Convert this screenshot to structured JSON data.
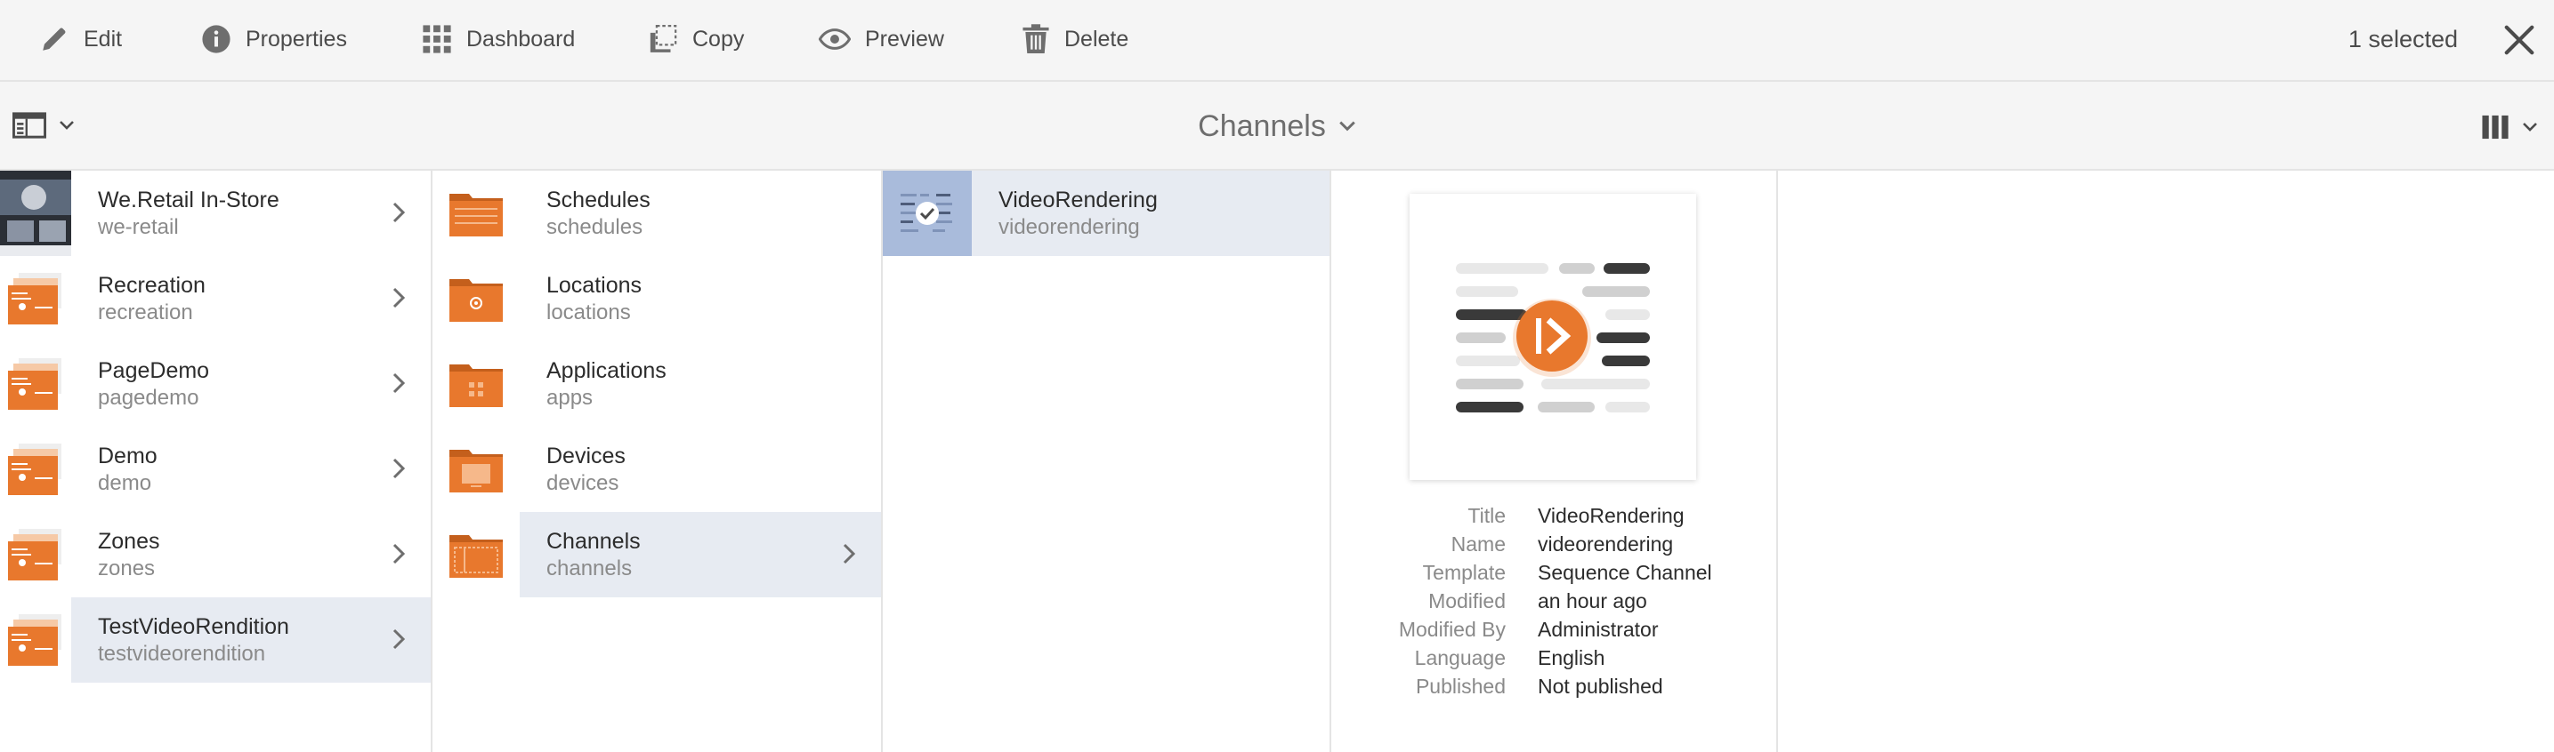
{
  "actionbar": {
    "edit": "Edit",
    "properties": "Properties",
    "dashboard": "Dashboard",
    "copy": "Copy",
    "preview": "Preview",
    "delete": "Delete",
    "selected_count": "1 selected"
  },
  "titlebar": {
    "title": "Channels"
  },
  "columns": {
    "col1": [
      {
        "title": "We.Retail In-Store",
        "name": "we-retail"
      },
      {
        "title": "Recreation",
        "name": "recreation"
      },
      {
        "title": "PageDemo",
        "name": "pagedemo"
      },
      {
        "title": "Demo",
        "name": "demo"
      },
      {
        "title": "Zones",
        "name": "zones"
      },
      {
        "title": "TestVideoRendition",
        "name": "testvideorendition"
      }
    ],
    "col2": [
      {
        "title": "Schedules",
        "name": "schedules"
      },
      {
        "title": "Locations",
        "name": "locations"
      },
      {
        "title": "Applications",
        "name": "apps"
      },
      {
        "title": "Devices",
        "name": "devices"
      },
      {
        "title": "Channels",
        "name": "channels"
      }
    ],
    "col3": [
      {
        "title": "VideoRendering",
        "name": "videorendering"
      }
    ]
  },
  "details": {
    "labels": {
      "title": "Title",
      "name": "Name",
      "template": "Template",
      "modified": "Modified",
      "modified_by": "Modified By",
      "language": "Language",
      "published": "Published"
    },
    "values": {
      "title": "VideoRendering",
      "name": "videorendering",
      "template": "Sequence Channel",
      "modified": "an hour ago",
      "modified_by": "Administrator",
      "language": "English",
      "published": "Not published"
    }
  },
  "colors": {
    "accent_orange": "#e8782d",
    "selection_bg": "#e7ebf2",
    "selected_thumb": "#a9bbdb"
  }
}
